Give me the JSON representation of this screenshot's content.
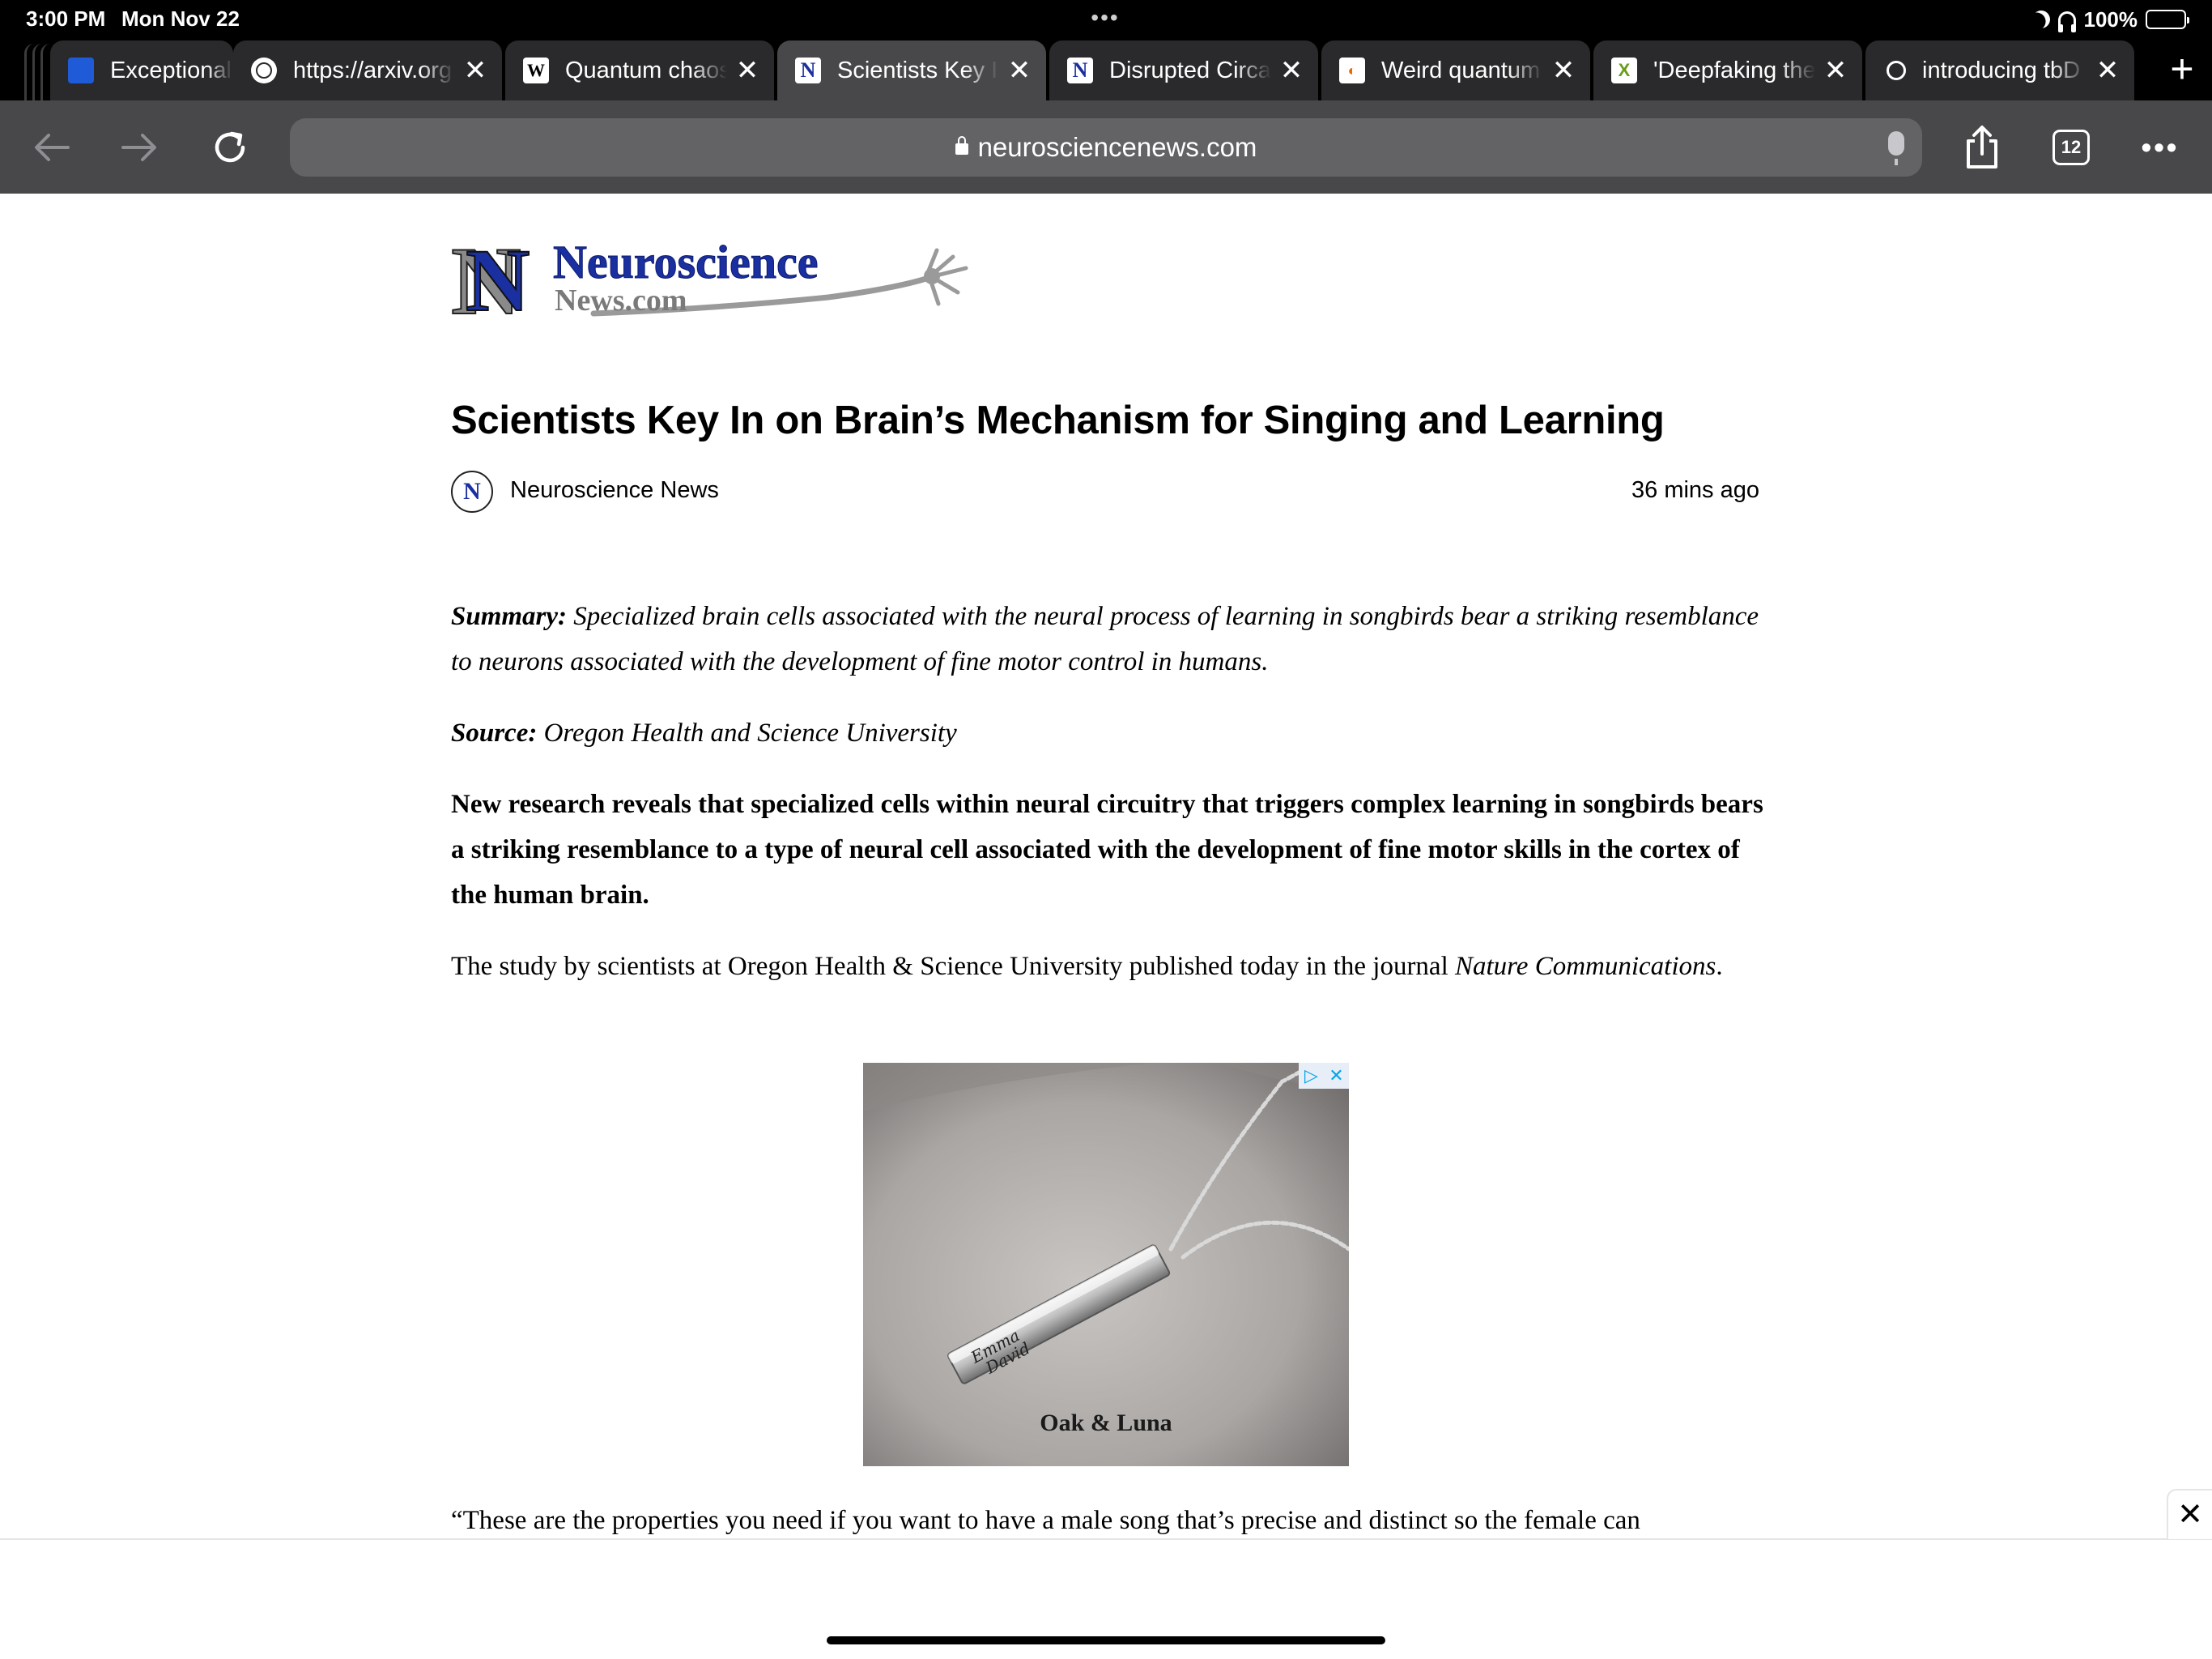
{
  "status_bar": {
    "time": "3:00 PM",
    "date": "Mon Nov 22",
    "battery": "100%",
    "battery_level": 1.0
  },
  "tabs": [
    {
      "title": "Exceptional",
      "favicon": "ars-icon",
      "active": false
    },
    {
      "title": "https://arxiv.org",
      "favicon": "globe-icon",
      "active": false
    },
    {
      "title": "Quantum chaos",
      "favicon": "wikipedia-icon",
      "active": false
    },
    {
      "title": "Scientists Key In",
      "favicon": "neuroscience-news-icon",
      "active": true
    },
    {
      "title": "Disrupted Circa",
      "favicon": "neuroscience-news-icon",
      "active": false
    },
    {
      "title": "Weird quantum",
      "favicon": "weird-quantum-icon",
      "active": false
    },
    {
      "title": "'Deepfaking the",
      "favicon": "x-icon",
      "active": false
    },
    {
      "title": "introducing tbD",
      "favicon": "generic-site-icon",
      "active": false
    }
  ],
  "toolbar": {
    "url": "neurosciencenews.com",
    "tabs_count": "12"
  },
  "logo": {
    "line1": "Neuroscience",
    "line2": "News.com"
  },
  "article": {
    "title": "Scientists Key In on Brain’s Mechanism for Singing and Learning",
    "author": "Neuroscience News",
    "posted": "36 mins ago",
    "summary_label": "Summary:",
    "summary_text": "Specialized brain cells associated with the neural process of learning in songbirds bear a striking resemblance to neurons associated with the development of fine motor control in humans.",
    "source_label": "Source:",
    "source_text": "Oregon Health and Science University",
    "lead": "New research reveals that specialized cells within neural circuitry that triggers complex learning in songbirds bears a striking resemblance to a type of neural cell associated with the development of fine motor skills in the cortex of the human brain.",
    "study_text": "The study by scientists at Oregon Health & Science University published today in the journal ",
    "journal": "Nature Communications",
    "study_end": ".",
    "quote_partial": "“These are the properties you need if you want to have a male song that’s precise and distinct so the female can"
  },
  "ad": {
    "engraving1": "Emma",
    "engraving2": "David",
    "brand": "Oak & Luna",
    "choices_glyph": "▷",
    "close_glyph": "✕"
  },
  "colors": {
    "chrome_dark": "#000000",
    "toolbar": "#48484a",
    "address_bar": "#636366",
    "active_tab": "#48484a",
    "brand_blue": "#1a2fa0"
  }
}
